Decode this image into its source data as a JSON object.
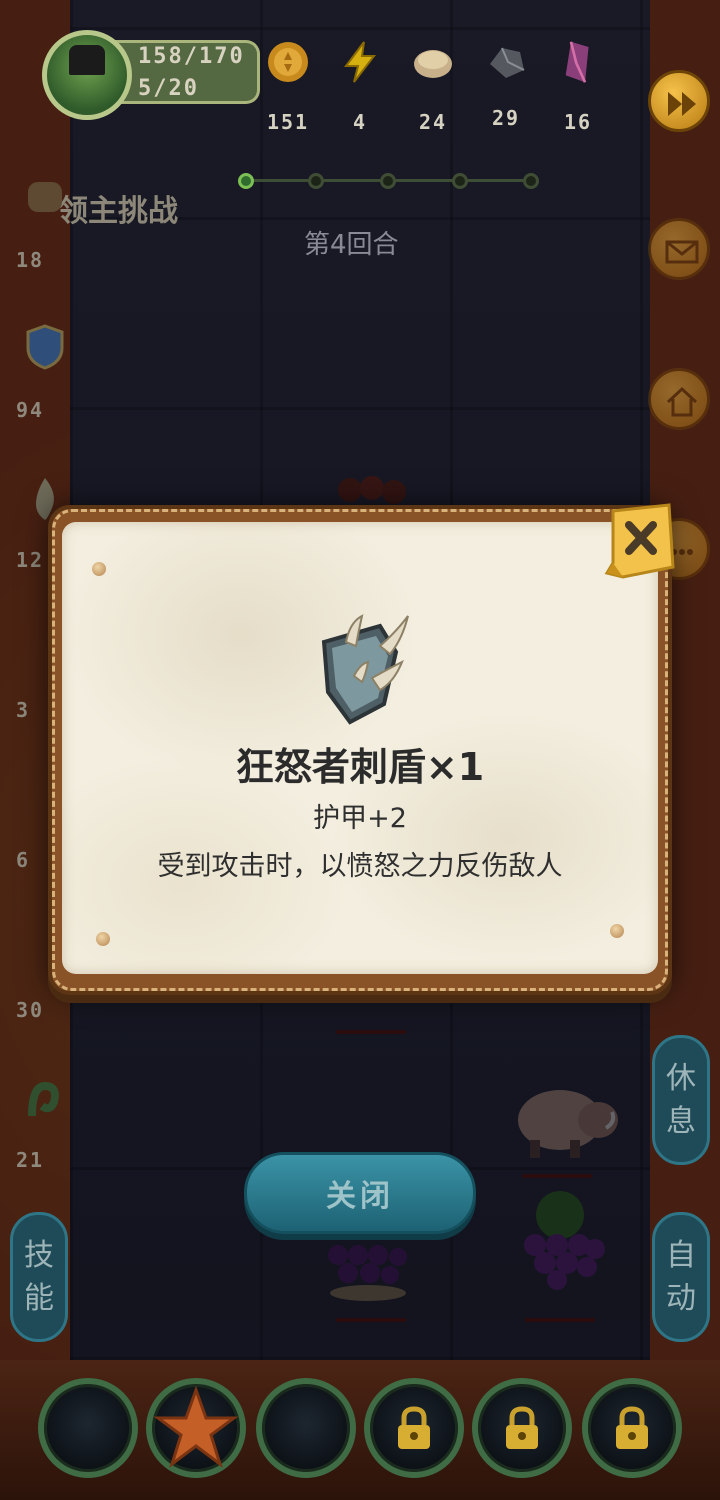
{
  "hud": {
    "hp": "158/170",
    "level": "5/20",
    "resources": [
      {
        "icon": "gold-coin-icon",
        "value": "151"
      },
      {
        "icon": "lightning-energy-icon",
        "value": "4"
      },
      {
        "icon": "bread-food-icon",
        "value": "24"
      },
      {
        "icon": "iron-ore-icon",
        "value": "29"
      },
      {
        "icon": "crystal-gem-icon",
        "value": "16"
      }
    ]
  },
  "stage": {
    "challenge_label": "领主挑战",
    "round_label": "第4回合"
  },
  "left_stats": [
    {
      "icon": "fist-attack-icon",
      "value": "18"
    },
    {
      "icon": "shield-defense-icon",
      "value": "94"
    },
    {
      "icon": "flame-icon",
      "value": "12"
    },
    {
      "icon": "unknown-stat-icon",
      "value": "3"
    },
    {
      "icon": "unknown-stat-icon-2",
      "value": "6"
    },
    {
      "icon": "unknown-stat-icon-3",
      "value": "30"
    },
    {
      "icon": "serpent-icon",
      "value": "21"
    }
  ],
  "side_tabs": {
    "rest": [
      "休",
      "息"
    ],
    "skills": [
      "技",
      "能"
    ],
    "auto": [
      "自",
      "动"
    ]
  },
  "modal": {
    "item_name": "狂怒者刺盾×1",
    "item_stat": "护甲+2",
    "item_description": "受到攻击时，以愤怒之力反伤敌人",
    "icon": "spiked-shield-icon"
  },
  "close_button_label": "关闭",
  "colors": {
    "modal_paper": "#f3eedf",
    "modal_frame": "#8a5327",
    "close_button": "#2a7d90",
    "close_tag": "#f2c24a"
  }
}
